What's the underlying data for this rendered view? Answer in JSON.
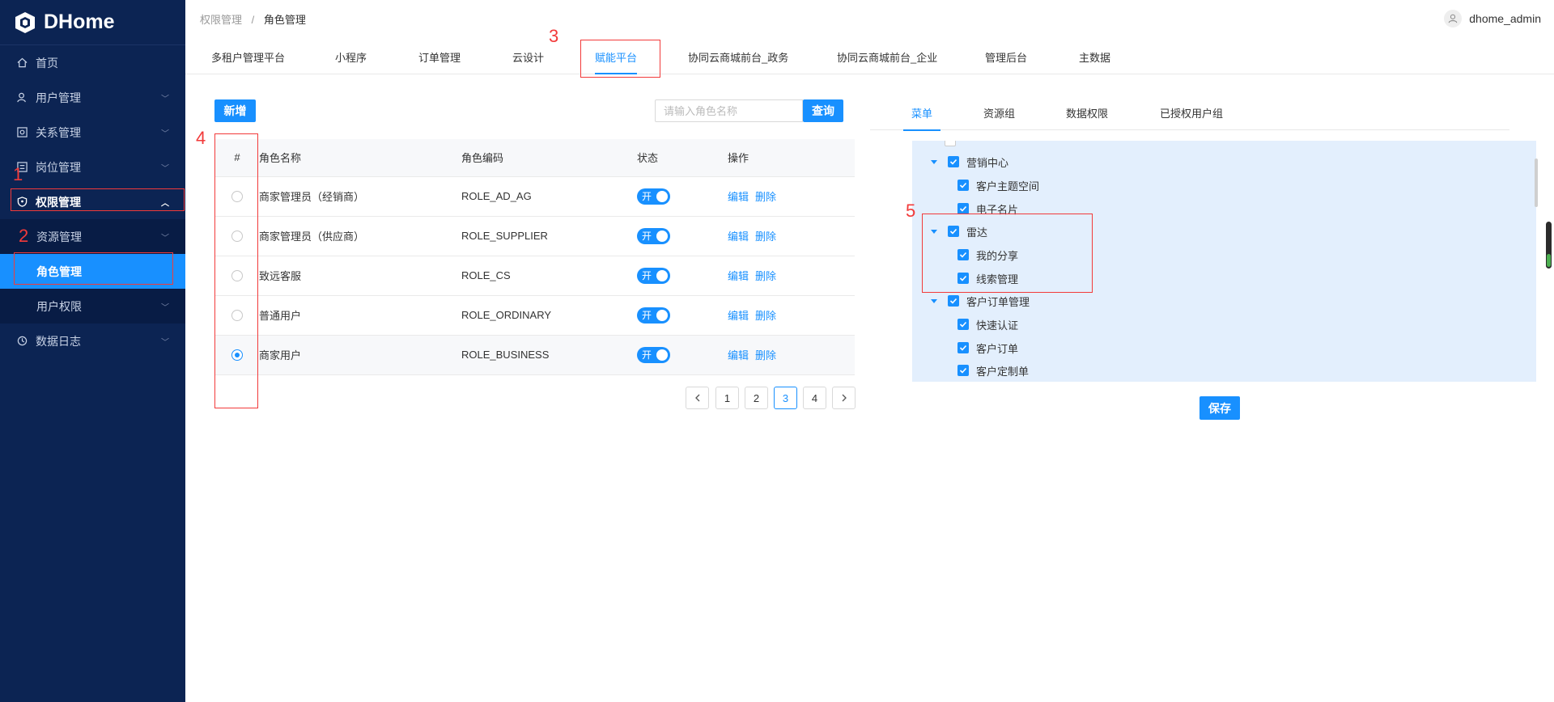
{
  "app": {
    "title": "DHome"
  },
  "sidebar": {
    "items": [
      {
        "label": "首页",
        "icon": "home-icon"
      },
      {
        "label": "用户管理",
        "icon": "user-icon"
      },
      {
        "label": "关系管理",
        "icon": "relation-icon"
      },
      {
        "label": "岗位管理",
        "icon": "post-icon"
      },
      {
        "label": "权限管理",
        "icon": "shield-icon"
      },
      {
        "label": "资源管理"
      },
      {
        "label": "角色管理"
      },
      {
        "label": "用户权限"
      },
      {
        "label": "数据日志",
        "icon": "log-icon"
      }
    ]
  },
  "annotations": {
    "a1": "1",
    "a2": "2",
    "a3": "3",
    "a4": "4",
    "a5": "5"
  },
  "breadcrumb": {
    "parent": "权限管理",
    "sep": "/",
    "current": "角色管理"
  },
  "user": {
    "name": "dhome_admin"
  },
  "tabs": [
    {
      "label": "多租户管理平台"
    },
    {
      "label": "小程序"
    },
    {
      "label": "订单管理"
    },
    {
      "label": "云设计"
    },
    {
      "label": "赋能平台"
    },
    {
      "label": "协同云商城前台_政务"
    },
    {
      "label": "协同云商城前台_企业"
    },
    {
      "label": "管理后台"
    },
    {
      "label": "主数据"
    }
  ],
  "toolbar": {
    "add_label": "新增",
    "search_placeholder": "请输入角色名称",
    "search_label": "查询"
  },
  "table": {
    "headers": [
      "#",
      "角色名称",
      "角色编码",
      "状态",
      "操作"
    ],
    "rows": [
      {
        "name": "商家管理员（经销商）",
        "code": "ROLE_AD_AG",
        "status": "开",
        "edit": "编辑",
        "delete": "删除"
      },
      {
        "name": "商家管理员（供应商）",
        "code": "ROLE_SUPPLIER",
        "status": "开",
        "edit": "编辑",
        "delete": "删除"
      },
      {
        "name": "致远客服",
        "code": "ROLE_CS",
        "status": "开",
        "edit": "编辑",
        "delete": "删除"
      },
      {
        "name": "普通用户",
        "code": "ROLE_ORDINARY",
        "status": "开",
        "edit": "编辑",
        "delete": "删除"
      },
      {
        "name": "商家用户",
        "code": "ROLE_BUSINESS",
        "status": "开",
        "edit": "编辑",
        "delete": "删除"
      }
    ]
  },
  "pagination": {
    "pages": [
      "1",
      "2",
      "3",
      "4"
    ],
    "current": "3"
  },
  "right_tabs": [
    {
      "label": "菜单"
    },
    {
      "label": "资源组"
    },
    {
      "label": "数据权限"
    },
    {
      "label": "已授权用户组"
    }
  ],
  "tree": {
    "nodes": [
      {
        "label": "营销中心"
      },
      {
        "label": "客户主题空间"
      },
      {
        "label": "电子名片"
      },
      {
        "label": "雷达"
      },
      {
        "label": "我的分享"
      },
      {
        "label": "线索管理"
      },
      {
        "label": "客户订单管理"
      },
      {
        "label": "快速认证"
      },
      {
        "label": "客户订单"
      },
      {
        "label": "客户定制单"
      }
    ]
  },
  "save_label": "保存"
}
